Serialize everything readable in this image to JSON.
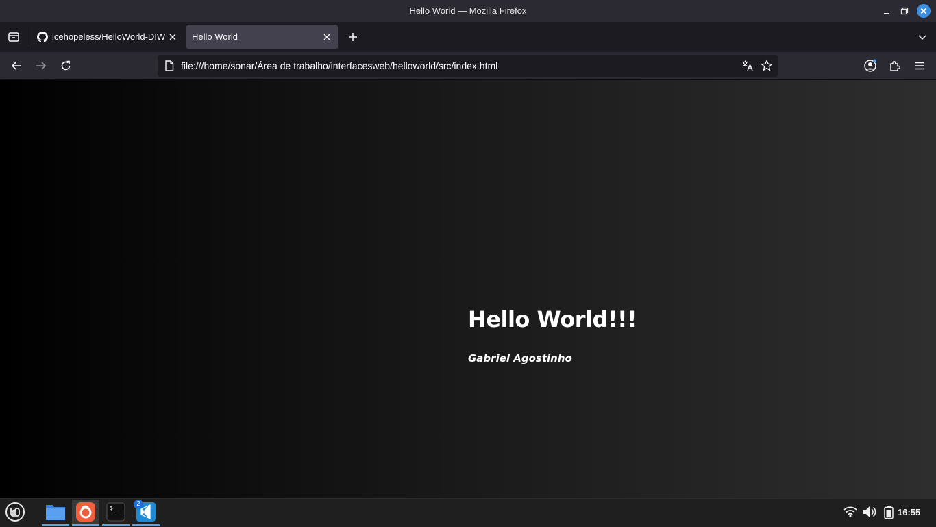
{
  "window": {
    "title": "Hello World — Mozilla Firefox"
  },
  "tabs": [
    {
      "label": "icehopeless/HelloWorld-DIW",
      "icon": "github-icon",
      "active": false
    },
    {
      "label": "Hello World",
      "active": true
    }
  ],
  "navbar": {
    "url": "file:///home/sonar/Área de trabalho/interfacesweb/helloworld/src/index.html"
  },
  "page": {
    "heading": "Hello World!!!",
    "author": "Gabriel Agostinho"
  },
  "taskbar": {
    "apps": [
      "mint-menu-icon",
      "files-icon",
      "firefox-icon",
      "terminal-icon",
      "vscode-icon"
    ],
    "vscode_badge": "2",
    "clock": "16:55"
  },
  "colors": {
    "accent": "#5ea2e8",
    "active_tab": "#42414d",
    "chrome": "#2b2a33"
  }
}
